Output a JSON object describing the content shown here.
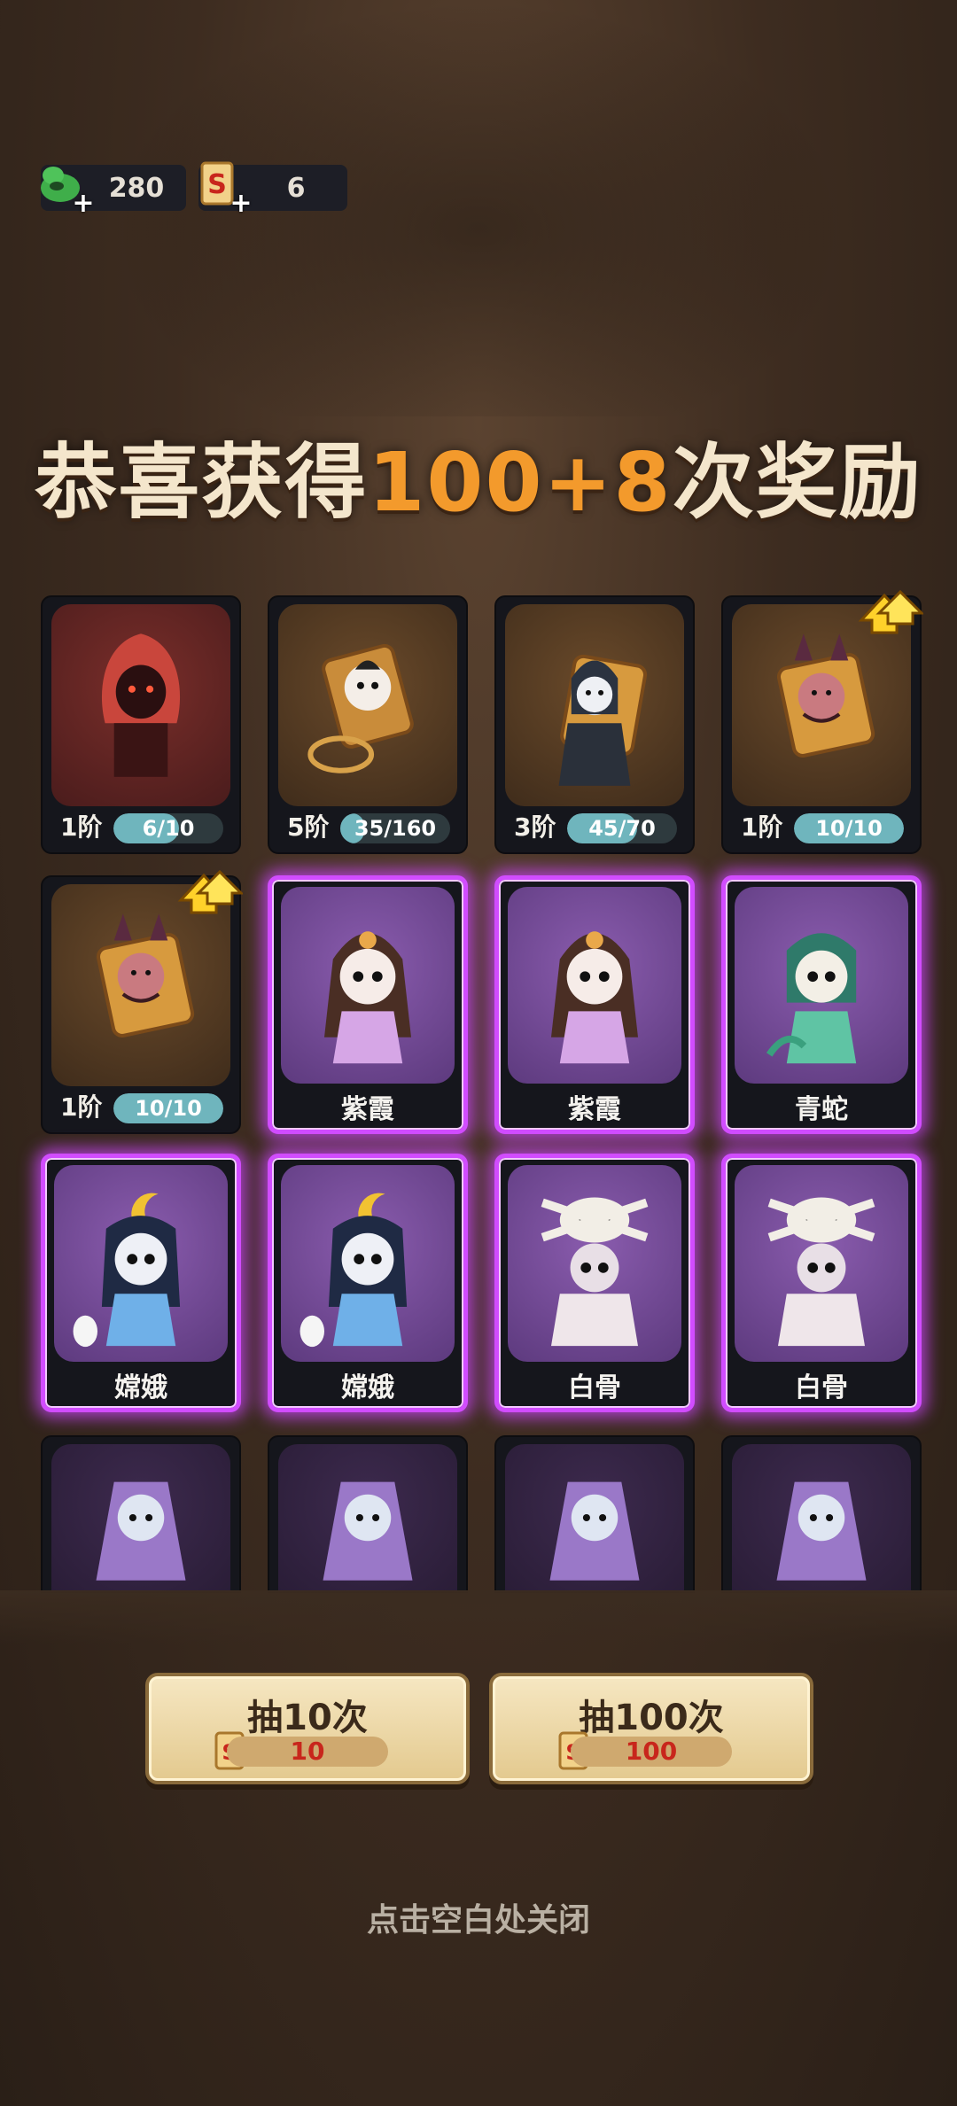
{
  "currencies": [
    {
      "icon": "green-gourd-icon",
      "value": "280"
    },
    {
      "icon": "scroll-ticket-icon",
      "value": "6"
    }
  ],
  "title": {
    "before": "恭喜获得",
    "highlight": "100+8",
    "after": "次奖励"
  },
  "cards": [
    {
      "tier": "1阶",
      "progress": "6/10",
      "fill": 0.6,
      "style": "owned",
      "art": "red-hooded-figure"
    },
    {
      "tier": "5阶",
      "progress": "35/160",
      "fill": 0.22,
      "style": "owned",
      "art": "opera-mask-warrior"
    },
    {
      "tier": "3阶",
      "progress": "45/70",
      "fill": 0.64,
      "style": "owned",
      "art": "dark-robed-scholar"
    },
    {
      "tier": "1阶",
      "progress": "10/10",
      "fill": 1.0,
      "style": "owned",
      "art": "horned-demon",
      "upgrade": true
    },
    {
      "tier": "1阶",
      "progress": "10/10",
      "fill": 1.0,
      "style": "owned",
      "art": "horned-demon",
      "upgrade": true
    },
    {
      "name": "紫霞",
      "style": "new",
      "art": "purple-fairy"
    },
    {
      "name": "紫霞",
      "style": "new",
      "art": "purple-fairy"
    },
    {
      "name": "青蛇",
      "style": "new",
      "art": "green-snake"
    },
    {
      "name": "嫦娥",
      "style": "new",
      "art": "moon-goddess"
    },
    {
      "name": "嫦娥",
      "style": "new",
      "art": "moon-goddess"
    },
    {
      "name": "白骨",
      "style": "new",
      "art": "skull-demon"
    },
    {
      "name": "白骨",
      "style": "new",
      "art": "skull-demon"
    }
  ],
  "buttons": [
    {
      "label": "抽10次",
      "cost": "10"
    },
    {
      "label": "抽100次",
      "cost": "100"
    }
  ],
  "close_hint": "点击空白处关闭",
  "colors": {
    "accent_orange": "#f39a2c",
    "glow_purple": "#d14cff",
    "progress_teal": "#6fb5bd",
    "cost_red": "#c8261c"
  }
}
